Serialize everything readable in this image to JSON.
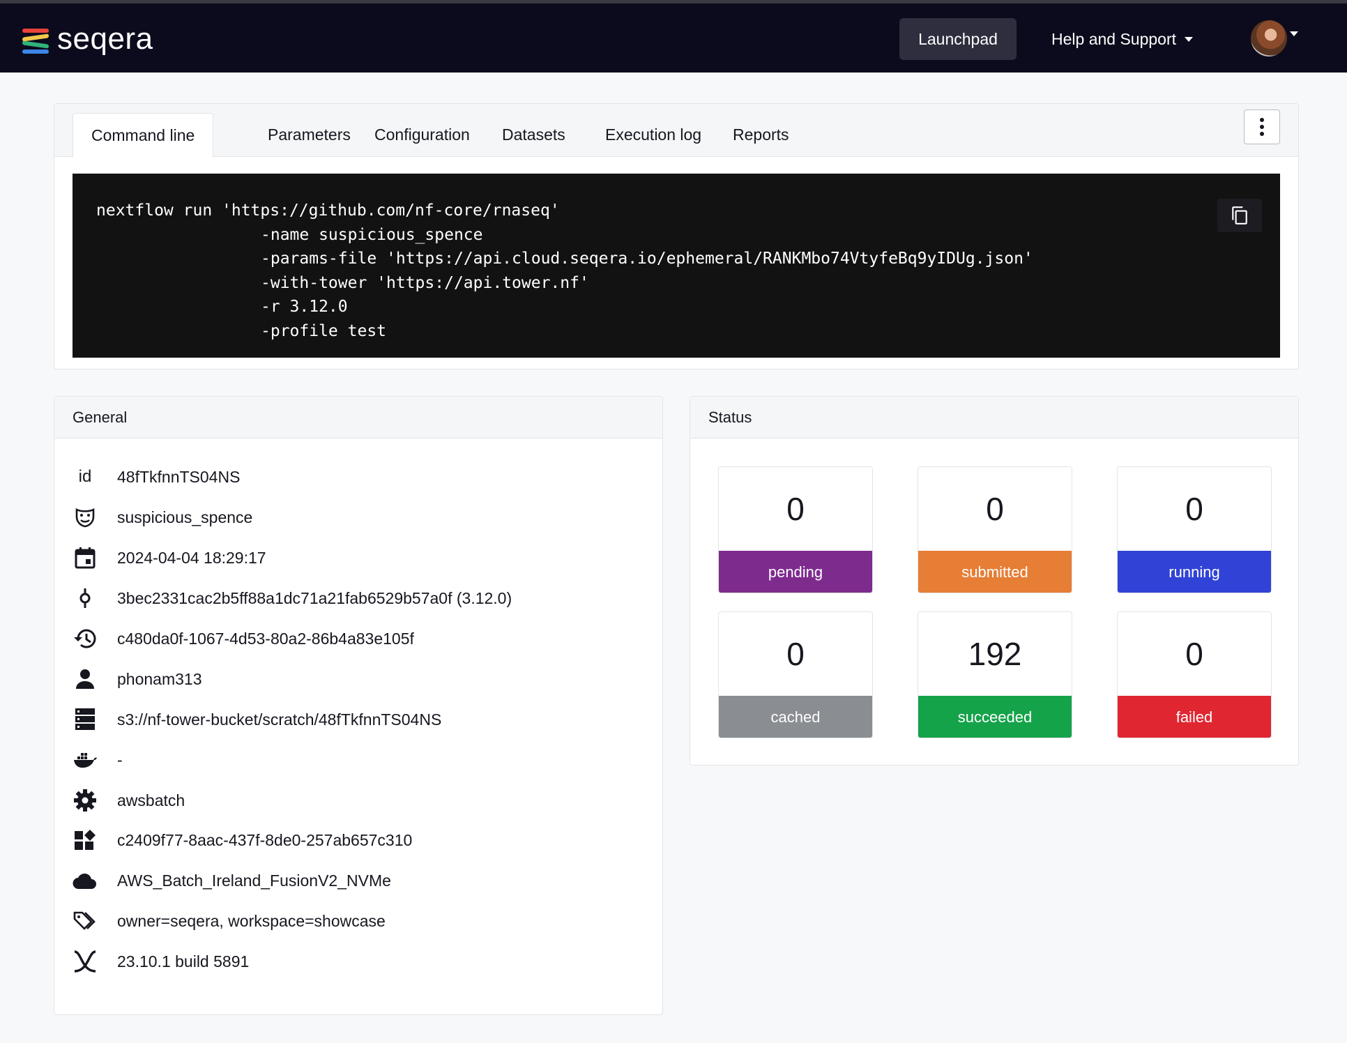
{
  "navbar": {
    "brand": "seqera",
    "launchpad_label": "Launchpad",
    "help_label": "Help and Support",
    "logo_colors": [
      "#e8433a",
      "#f4c84a",
      "#31b27a",
      "#3c86e6"
    ]
  },
  "tabs": [
    {
      "label": "Command line",
      "active": true
    },
    {
      "label": "Parameters"
    },
    {
      "label": "Configuration"
    },
    {
      "label": "Datasets"
    },
    {
      "label": "Execution log"
    },
    {
      "label": "Reports"
    }
  ],
  "command": {
    "lines": [
      "nextflow run 'https://github.com/nf-core/rnaseq'",
      "-name suspicious_spence",
      "-params-file 'https://api.cloud.seqera.io/ephemeral/RANKMbo74VtyfeBq9yIDUg.json'",
      "-with-tower 'https://api.tower.nf'",
      "-r 3.12.0",
      "-profile test"
    ]
  },
  "general": {
    "title": "General",
    "id_label": "id",
    "rows": [
      {
        "icon": "id-label",
        "value": "48fTkfnnTS04NS"
      },
      {
        "icon": "theater-masks-icon",
        "value": "suspicious_spence"
      },
      {
        "icon": "calendar-icon",
        "value": "2024-04-04 18:29:17"
      },
      {
        "icon": "commit-icon",
        "value": "3bec2331cac2b5ff88a1dc71a21fab6529b57a0f (3.12.0)"
      },
      {
        "icon": "history-icon",
        "value": "c480da0f-1067-4d53-80a2-86b4a83e105f"
      },
      {
        "icon": "user-icon",
        "value": "phonam313"
      },
      {
        "icon": "storage-icon",
        "value": "s3://nf-tower-bucket/scratch/48fTkfnnTS04NS"
      },
      {
        "icon": "docker-icon",
        "value": "-"
      },
      {
        "icon": "gear-icon",
        "value": "awsbatch"
      },
      {
        "icon": "widgets-icon",
        "value": "c2409f77-8aac-437f-8de0-257ab657c310"
      },
      {
        "icon": "cloud-icon",
        "value": "AWS_Batch_Ireland_FusionV2_NVMe"
      },
      {
        "icon": "tags-icon",
        "value": "owner=seqera, workspace=showcase"
      },
      {
        "icon": "nextflow-icon",
        "value": "23.10.1 build 5891"
      }
    ]
  },
  "status": {
    "title": "Status",
    "items": [
      {
        "count": "0",
        "label": "pending",
        "color": "#7e2b8e"
      },
      {
        "count": "0",
        "label": "submitted",
        "color": "#e67e36"
      },
      {
        "count": "0",
        "label": "running",
        "color": "#3142d6"
      },
      {
        "count": "0",
        "label": "cached",
        "color": "#8a8d92"
      },
      {
        "count": "192",
        "label": "succeeded",
        "color": "#15a34a"
      },
      {
        "count": "0",
        "label": "failed",
        "color": "#e02631"
      }
    ]
  }
}
